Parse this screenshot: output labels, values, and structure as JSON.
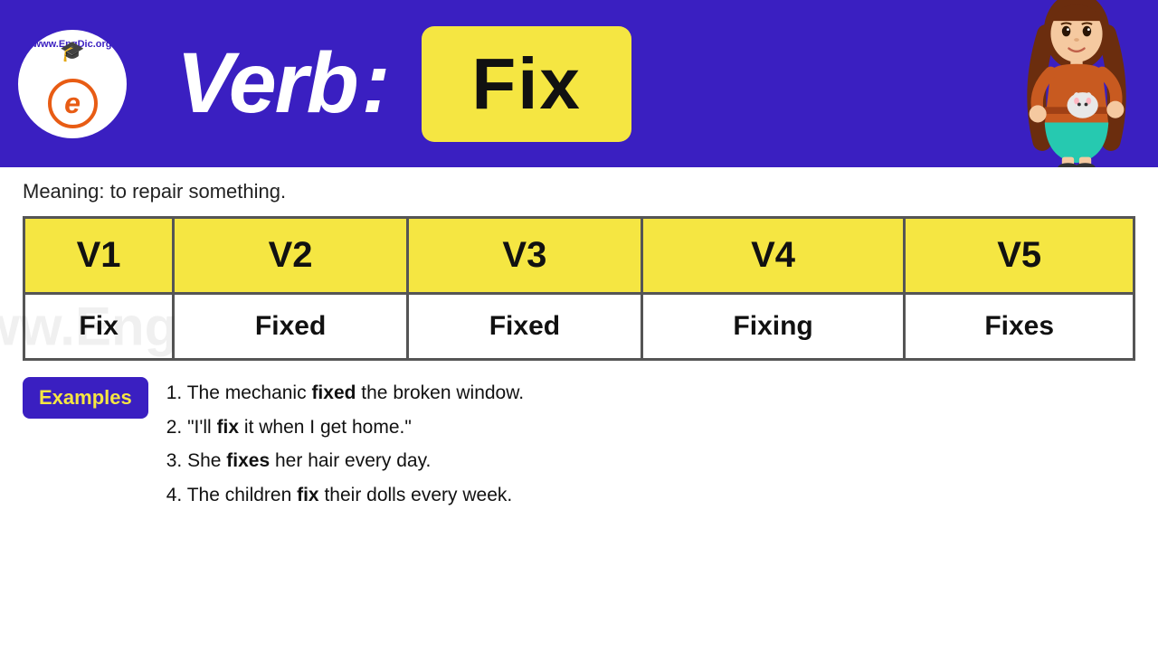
{
  "header": {
    "logo_top": "www.EngDic.org",
    "logo_letter": "e",
    "verb_label": "Verb",
    "colon": ":",
    "fix_word": "Fix"
  },
  "meaning": {
    "label": "Meaning:",
    "text": "to repair something."
  },
  "table": {
    "headers": [
      "V1",
      "V2",
      "V3",
      "V4",
      "V5"
    ],
    "values": [
      "Fix",
      "Fixed",
      "Fixed",
      "Fixing",
      "Fixes"
    ]
  },
  "examples": {
    "badge_label": "Examples",
    "items": [
      {
        "number": "1.",
        "pre": "The mechanic ",
        "bold": "fixed",
        "post": " the broken window."
      },
      {
        "number": "2.",
        "pre": "\"I'll ",
        "bold": "fix",
        "post": " it when I get home.\""
      },
      {
        "number": "3.",
        "pre": "She ",
        "bold": "fixes",
        "post": " her hair every day."
      },
      {
        "number": "4.",
        "pre": "The children ",
        "bold": "fix",
        "post": " their dolls every week."
      }
    ]
  }
}
